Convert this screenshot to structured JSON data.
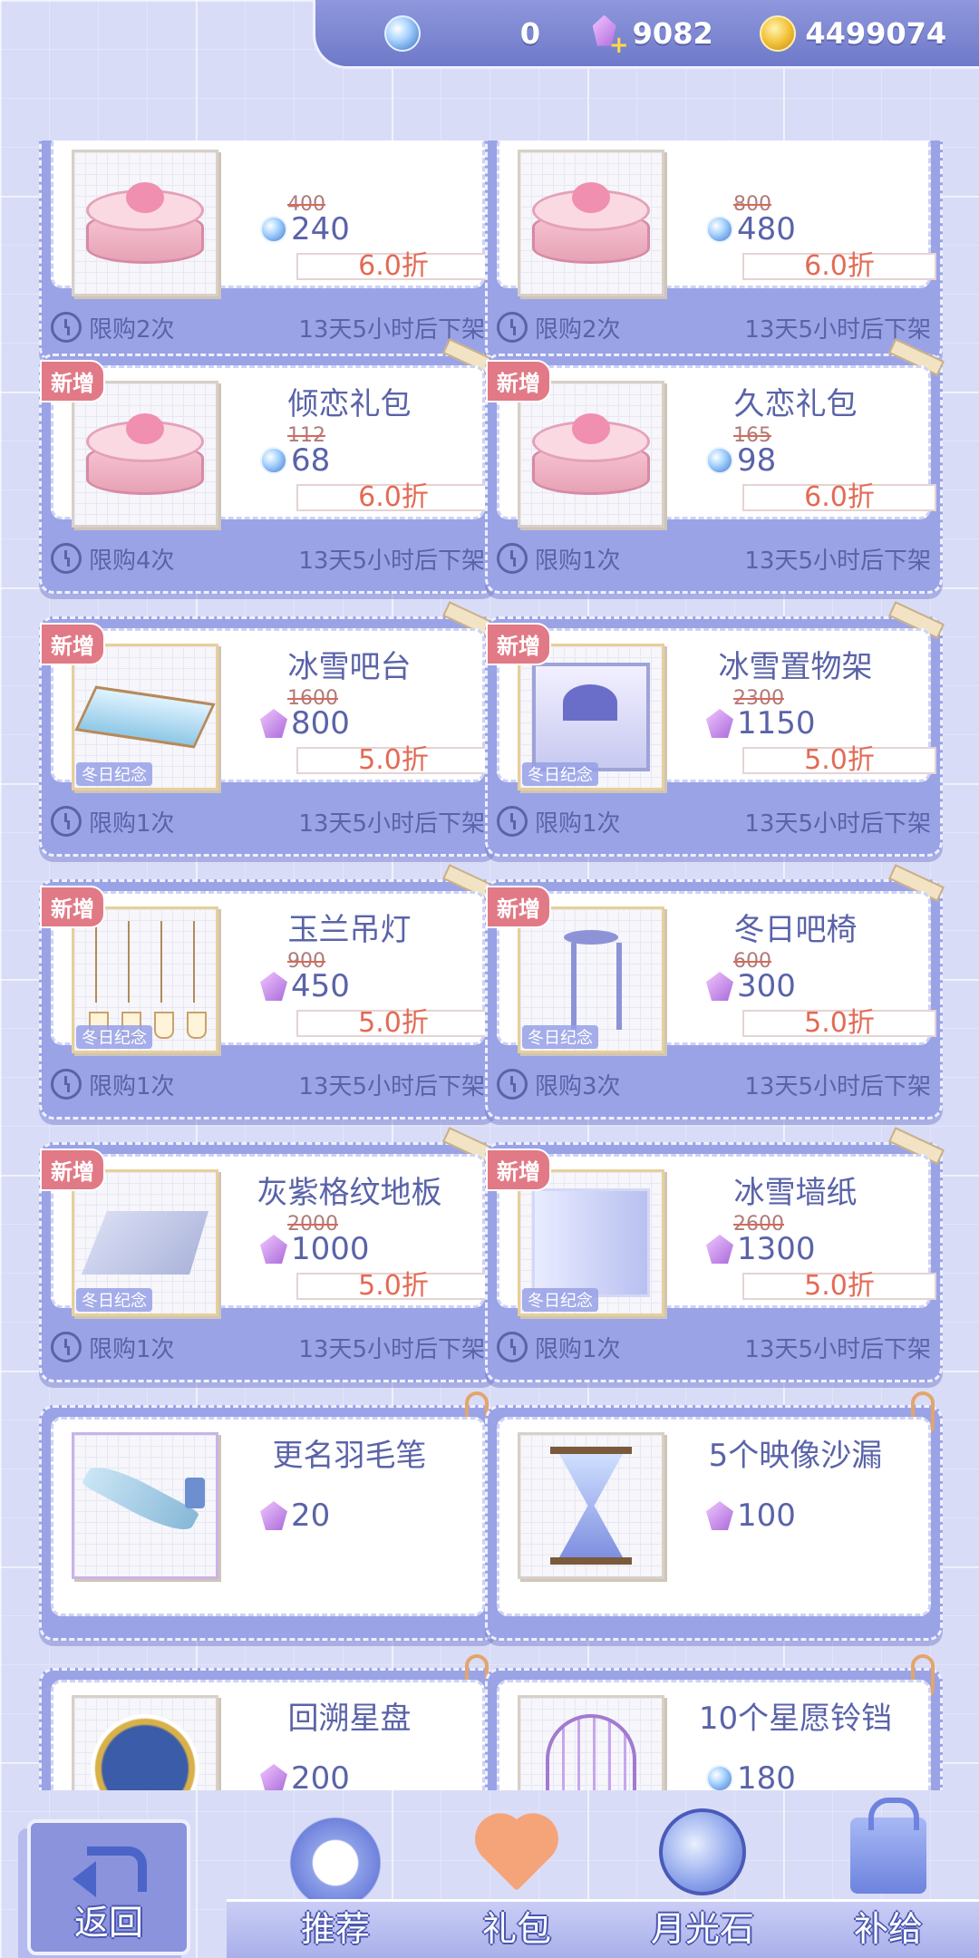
{
  "currency": {
    "diamond": "0",
    "crystal": "9082",
    "coin": "4499074",
    "icons": [
      "diamond-icon",
      "crystal-plus-icon",
      "coin-icon"
    ]
  },
  "common": {
    "new_badge": "新增",
    "winter_tag": "冬日纪念",
    "remove_time": "13天5小时后下架"
  },
  "items": [
    {
      "name": "",
      "old_price": "400",
      "price": "240",
      "currency": "diamond",
      "discount": "6.0折",
      "limit": "限购2次",
      "art": "cake"
    },
    {
      "name": "",
      "old_price": "800",
      "price": "480",
      "currency": "diamond",
      "discount": "6.0折",
      "limit": "限购2次",
      "art": "cake"
    },
    {
      "name": "倾恋礼包",
      "old_price": "112",
      "price": "68",
      "currency": "diamond",
      "discount": "6.0折",
      "limit": "限购4次",
      "art": "cake"
    },
    {
      "name": "久恋礼包",
      "old_price": "165",
      "price": "98",
      "currency": "diamond",
      "discount": "6.0折",
      "limit": "限购1次",
      "art": "cake"
    },
    {
      "name": "冰雪吧台",
      "old_price": "1600",
      "price": "800",
      "currency": "crystal",
      "discount": "5.0折",
      "limit": "限购1次",
      "art": "bar"
    },
    {
      "name": "冰雪置物架",
      "old_price": "2300",
      "price": "1150",
      "currency": "crystal",
      "discount": "5.0折",
      "limit": "限购1次",
      "art": "shelf"
    },
    {
      "name": "玉兰吊灯",
      "old_price": "900",
      "price": "450",
      "currency": "crystal",
      "discount": "5.0折",
      "limit": "限购1次",
      "art": "lamps"
    },
    {
      "name": "冬日吧椅",
      "old_price": "600",
      "price": "300",
      "currency": "crystal",
      "discount": "5.0折",
      "limit": "限购3次",
      "art": "stool"
    },
    {
      "name": "灰紫格纹地板",
      "old_price": "2000",
      "price": "1000",
      "currency": "crystal",
      "discount": "5.0折",
      "limit": "限购1次",
      "art": "floor"
    },
    {
      "name": "冰雪墙纸",
      "old_price": "2600",
      "price": "1300",
      "currency": "crystal",
      "discount": "5.0折",
      "limit": "限购1次",
      "art": "wall"
    }
  ],
  "plain_items": [
    {
      "name": "更名羽毛笔",
      "price": "20",
      "currency": "crystal",
      "art": "quill"
    },
    {
      "name": "5个映像沙漏",
      "price": "100",
      "currency": "crystal",
      "art": "hourglass"
    },
    {
      "name": "回溯星盘",
      "price": "200",
      "currency": "crystal",
      "art": "clock"
    },
    {
      "name": "10个星愿铃铛",
      "price": "180",
      "currency": "diamond",
      "art": "cage"
    }
  ],
  "nav": {
    "back": "返回",
    "tabs": [
      "推荐",
      "礼包",
      "月光石",
      "补给"
    ],
    "active_tab": "礼包"
  }
}
